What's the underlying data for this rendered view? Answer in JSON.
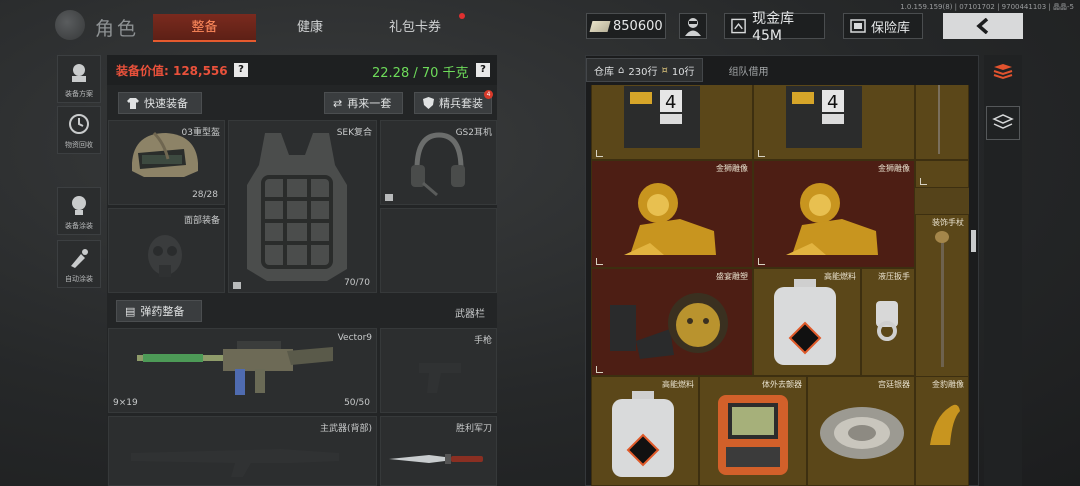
{
  "header": {
    "title": "角色",
    "tabs": [
      {
        "label": "整备",
        "active": true
      },
      {
        "label": "健康",
        "active": false
      },
      {
        "label": "礼包卡券",
        "active": false
      }
    ],
    "version": "1.0.159.159(8) | 07101702 | 9700441103 | 晶晶-5",
    "money": "850600",
    "cash_vault": "现金库 45M",
    "safe": "保险库"
  },
  "sidebar": [
    {
      "label": "装备方案",
      "icon": "equipment-plan-icon"
    },
    {
      "label": "物资回收",
      "icon": "recycle-icon"
    },
    {
      "label": "装备涂装",
      "icon": "skin-icon"
    },
    {
      "label": "自动涂装",
      "icon": "auto-skin-icon"
    }
  ],
  "equipment": {
    "value_label": "装备价值: 128,556",
    "weight": "22.28 / 70",
    "weight_unit": "千克",
    "help": "?",
    "quick_equip": "快速装备",
    "repeat": "再来一套",
    "elite": "精兵套装",
    "elite_badge": "4",
    "helmet": {
      "name": "03重型盔",
      "durability": "28/28"
    },
    "armor": {
      "name": "SEK复合",
      "durability": "70/70"
    },
    "headset": {
      "name": "GS2耳机"
    },
    "face": {
      "name": "面部装备"
    },
    "ammo_button": "弹药整备",
    "weapon_slot_title": "武器栏",
    "primary": {
      "name": "Vector9",
      "caliber": "9×19",
      "ammo": "50/50"
    },
    "pistol": {
      "name": "手枪"
    },
    "back_weapon": {
      "name": "主武器(背部)"
    },
    "knife": {
      "name": "胜利军刀"
    }
  },
  "inventory": {
    "tab_storage": "仓库",
    "rows_a": "230行",
    "rows_b": "10行",
    "tab_team": "组队借用",
    "items": [
      {
        "label": "",
        "kind": "box4"
      },
      {
        "label": "",
        "kind": "box4"
      },
      {
        "label": "金狮雕像",
        "kind": "lion"
      },
      {
        "label": "金狮雕像",
        "kind": "lion"
      },
      {
        "label": "装饰手杖",
        "kind": "cane"
      },
      {
        "label": "盛宴雕塑",
        "kind": "bust"
      },
      {
        "label": "高能燃料",
        "kind": "fuel"
      },
      {
        "label": "液压扳手",
        "kind": "wrench"
      },
      {
        "label": "高能燃料",
        "kind": "fuel"
      },
      {
        "label": "体外去颤器",
        "kind": "defib"
      },
      {
        "label": "宫廷银器",
        "kind": "silver"
      },
      {
        "label": "金豹雕像",
        "kind": "leopard"
      }
    ]
  },
  "colors": {
    "accent": "#e9513b",
    "weight": "#6edc5a",
    "grid_gold": "#55431a",
    "grid_red": "#4d1e14"
  }
}
